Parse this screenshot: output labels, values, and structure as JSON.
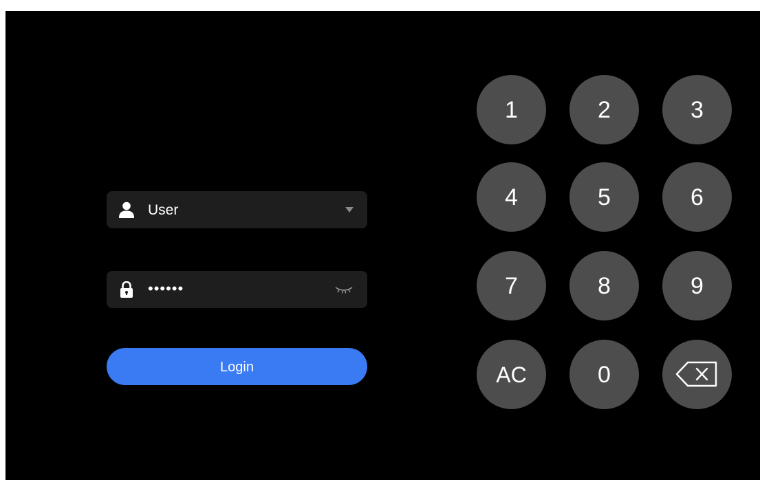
{
  "login_form": {
    "user_field": {
      "value": "User",
      "lead_icon": "user-icon",
      "trail_icon": "chevron-down-icon"
    },
    "password_field": {
      "masked_value": "••••••",
      "lead_icon": "lock-icon",
      "trail_icon": "eye-closed-icon"
    },
    "login_label": "Login"
  },
  "keypad": {
    "keys": [
      "1",
      "2",
      "3",
      "4",
      "5",
      "6",
      "7",
      "8",
      "9",
      "AC",
      "0"
    ],
    "backspace_icon": "backspace-icon"
  },
  "colors": {
    "background": "#000000",
    "field": "#1e1e1e",
    "key": "#4d4d4d",
    "accent": "#3a7bf3",
    "text": "#ffffff"
  }
}
